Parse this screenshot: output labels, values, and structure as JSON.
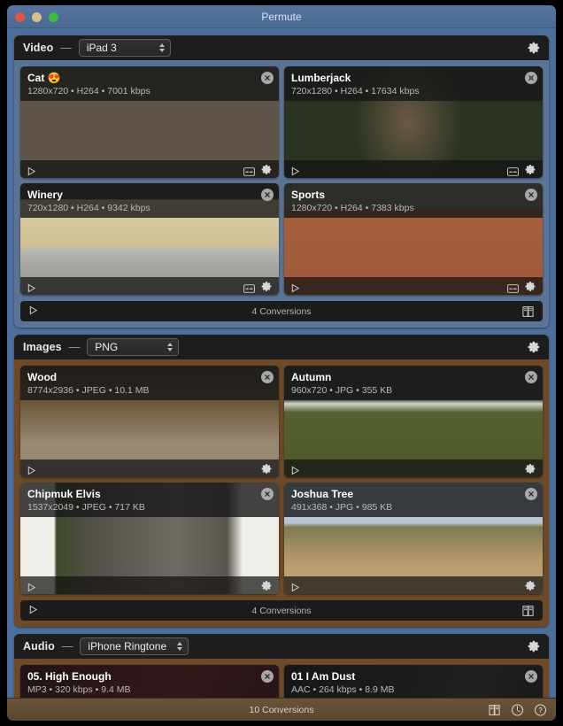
{
  "window": {
    "title": "Permute",
    "traffic_lights": [
      "close-red",
      "minimize-yellow",
      "zoom-green"
    ]
  },
  "colors": {
    "video_section": "#5b7496",
    "images_section": "#6d4a29",
    "audio_section": "#6d4a29",
    "titlebar": "#4d6e99",
    "card_background": "#2b2b2b",
    "statusbar": "#6a5339"
  },
  "sections": [
    {
      "key": "video",
      "title": "Video",
      "dash": "—",
      "preset": "iPad 3",
      "gear_icon": "gear-icon",
      "footer": {
        "count": "4 Conversions",
        "play_icon": "play-icon",
        "preset_icon": "presets-icon"
      },
      "items": [
        {
          "name": "Cat 😍",
          "meta": "1280x720 • H264 • 7001 kbps",
          "thumb": "th-cat",
          "has_subtitles": true
        },
        {
          "name": "Lumberjack",
          "meta": "720x1280 • H264 • 17634 kbps",
          "thumb": "th-lumber",
          "has_subtitles": true
        },
        {
          "name": "Winery",
          "meta": "720x1280 • H264 • 9342 kbps",
          "thumb": "th-winery",
          "has_subtitles": true
        },
        {
          "name": "Sports",
          "meta": "1280x720 • H264 • 7383 kbps",
          "thumb": "th-sports",
          "has_subtitles": true
        }
      ]
    },
    {
      "key": "images",
      "title": "Images",
      "dash": "—",
      "preset": "PNG",
      "gear_icon": "gear-icon",
      "footer": {
        "count": "4 Conversions",
        "play_icon": "play-icon",
        "preset_icon": "presets-icon"
      },
      "items": [
        {
          "name": "Wood",
          "meta": "8774x2936 • JPEG • 10.1 MB",
          "thumb": "th-wood",
          "has_subtitles": false
        },
        {
          "name": "Autumn",
          "meta": "960x720 • JPG • 355 KB",
          "thumb": "th-autumn",
          "has_subtitles": false
        },
        {
          "name": "Chipmuk Elvis",
          "meta": "1537x2049 • JPEG • 717 KB",
          "thumb": "th-chip",
          "has_subtitles": false
        },
        {
          "name": "Joshua Tree",
          "meta": "491x368 • JPG • 985 KB",
          "thumb": "th-joshua",
          "has_subtitles": false
        }
      ]
    },
    {
      "key": "audio",
      "title": "Audio",
      "dash": "—",
      "preset": "iPhone Ringtone",
      "gear_icon": "gear-icon",
      "footer": null,
      "items": [
        {
          "name": "05. High Enough",
          "meta": "MP3 • 320 kbps • 9.4 MB",
          "thumb": "th-hoodoo",
          "has_subtitles": false
        },
        {
          "name": "01 I Am Dust",
          "meta": "AAC • 264 kbps • 8.9 MB",
          "thumb": "th-dust",
          "has_subtitles": false
        }
      ]
    }
  ],
  "statusbar": {
    "count": "10 Conversions",
    "icons": [
      "presets-icon",
      "clock-icon",
      "help-icon"
    ]
  }
}
